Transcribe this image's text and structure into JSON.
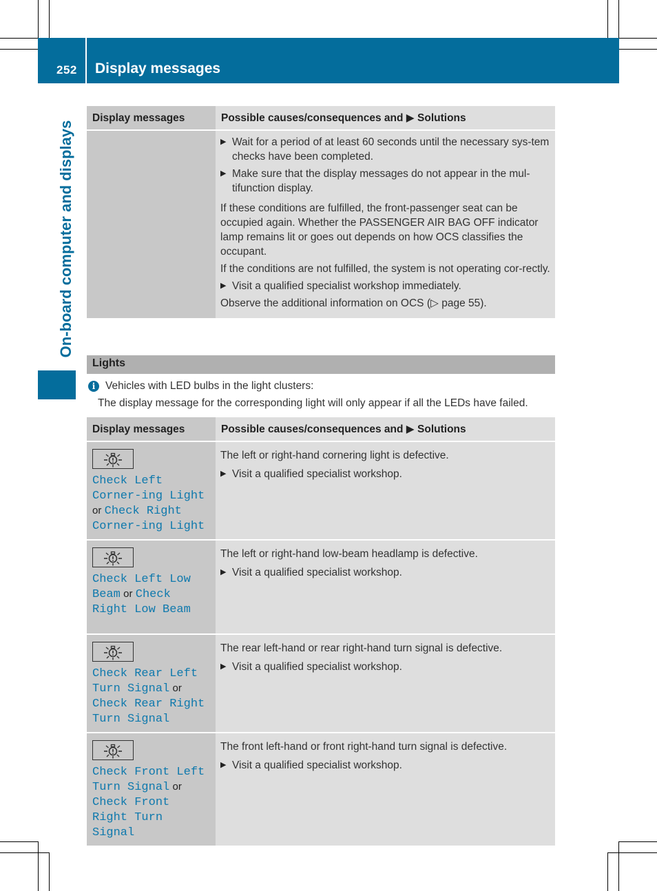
{
  "header": {
    "page_number": "252",
    "title": "Display messages"
  },
  "side_tab": {
    "label": "On-board computer and displays"
  },
  "colors": {
    "brand": "#046d9c",
    "display_text": "#0f79ad",
    "header_cell_dark": "#c8c8c8",
    "header_cell_light": "#dedede",
    "section_bar": "#b0b0b0"
  },
  "table1": {
    "columns": [
      "Display messages",
      "Possible causes/consequences and",
      "Solutions"
    ],
    "rows": [
      {
        "message": "",
        "content": [
          {
            "type": "bullet",
            "text": "Wait for a period of at least 60 seconds until the necessary sys-tem checks have been completed."
          },
          {
            "type": "bullet",
            "text": "Make sure that the display messages do not appear in the mul-tifunction display."
          },
          {
            "type": "para",
            "text": "If these conditions are fulfilled, the front-passenger seat can be occupied again. Whether the PASSENGER AIR BAG OFF indicator lamp remains lit or goes out depends on how OCS classifies the occupant."
          },
          {
            "type": "para",
            "text": "If the conditions are not fulfilled, the system is not operating cor-rectly."
          },
          {
            "type": "bullet",
            "text": "Visit a qualified specialist workshop immediately."
          },
          {
            "type": "para",
            "text": "Observe the additional information on OCS (▷ page 55)."
          }
        ]
      }
    ]
  },
  "lights": {
    "section_title": "Lights",
    "info_icon": "info-icon",
    "info_line1": "Vehicles with LED bulbs in the light clusters:",
    "info_line2": "The display message for the corresponding light will only appear if all the LEDs have failed.",
    "table": {
      "columns": [
        "Display messages",
        "Possible causes/consequences and",
        "Solutions"
      ],
      "rows": [
        {
          "icon": "bulb-warning-icon",
          "message_a": "Check Left Corner-ing Light",
          "or": "or",
          "message_b": "Check Right Corner-ing Light",
          "cause": "The left or right-hand cornering light is defective.",
          "solution": "Visit a qualified specialist workshop."
        },
        {
          "icon": "bulb-warning-icon",
          "message_a": "Check Left Low Beam",
          "or": "or",
          "message_b": "Check Right Low Beam",
          "cause": "The left or right-hand low-beam headlamp is defective.",
          "solution": "Visit a qualified specialist workshop."
        },
        {
          "icon": "bulb-warning-icon",
          "message_a": "Check Rear Left Turn Signal",
          "or": "or",
          "message_b": "Check Rear Right Turn Signal",
          "cause": "The rear left-hand or rear right-hand turn signal is defective.",
          "solution": "Visit a qualified specialist workshop."
        },
        {
          "icon": "bulb-warning-icon",
          "message_a": "Check Front Left Turn Signal",
          "or": "or",
          "message_b": "Check Front Right Turn Signal",
          "cause": "The front left-hand or front right-hand turn signal is defective.",
          "solution": "Visit a qualified specialist workshop."
        }
      ]
    }
  }
}
